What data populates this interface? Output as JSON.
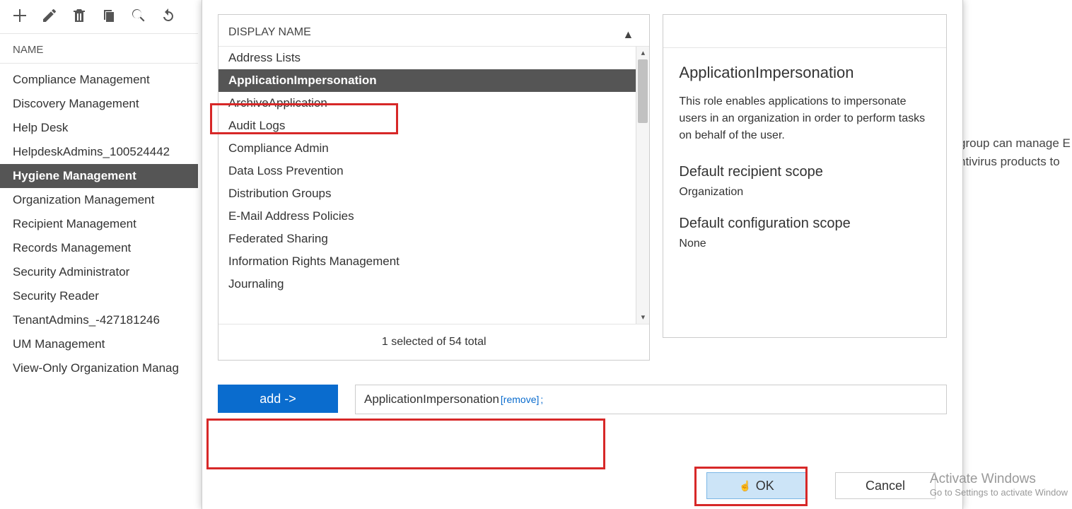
{
  "sidebar": {
    "column_header": "NAME",
    "items": [
      "Compliance Management",
      "Discovery Management",
      "Help Desk",
      "HelpdeskAdmins_100524442",
      "Hygiene Management",
      "Organization Management",
      "Recipient Management",
      "Records Management",
      "Security Administrator",
      "Security Reader",
      "TenantAdmins_-427181246",
      "UM Management",
      "View-Only Organization Manag"
    ],
    "selected_index": 4
  },
  "background_panel": {
    "line1": "group can manage E",
    "line2": "ntivirus products to"
  },
  "modal": {
    "list": {
      "header": "DISPLAY NAME",
      "rows": [
        "Address Lists",
        "ApplicationImpersonation",
        "ArchiveApplication",
        "Audit Logs",
        "Compliance Admin",
        "Data Loss Prevention",
        "Distribution Groups",
        "E-Mail Address Policies",
        "Federated Sharing",
        "Information Rights Management",
        "Journaling"
      ],
      "selected_index": 1,
      "footer": "1 selected of 54 total"
    },
    "detail": {
      "title": "ApplicationImpersonation",
      "description": "This role enables applications to impersonate users in an organization in order to perform tasks on behalf of the user.",
      "recipient_scope_label": "Default recipient scope",
      "recipient_scope_value": "Organization",
      "config_scope_label": "Default configuration scope",
      "config_scope_value": "None"
    },
    "add": {
      "button_label": "add ->",
      "added_item": "ApplicationImpersonation",
      "remove_label": "[remove]",
      "trailing": ";"
    },
    "buttons": {
      "ok": "OK",
      "cancel": "Cancel"
    }
  },
  "watermark": {
    "title": "Activate Windows",
    "subtitle": "Go to Settings to activate Window"
  }
}
